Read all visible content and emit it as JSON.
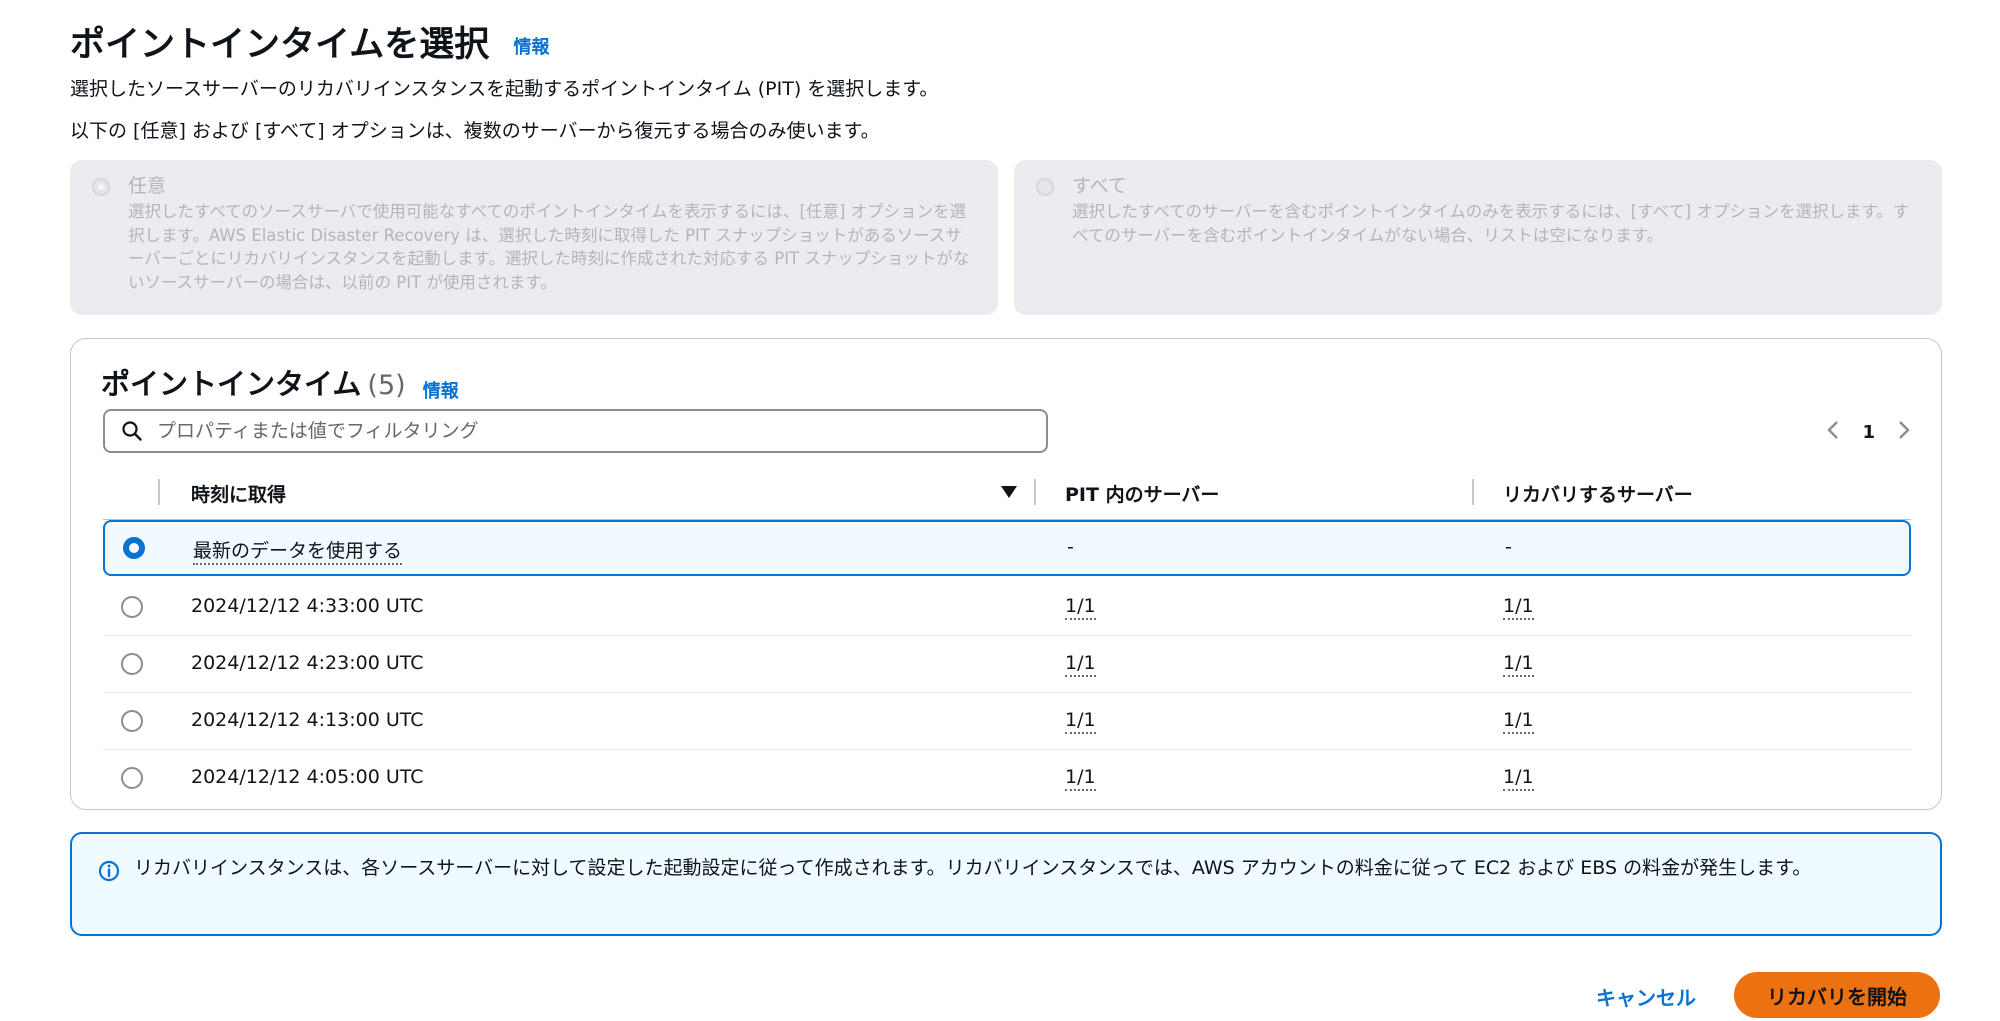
{
  "header": {
    "title": "ポイントインタイムを選択",
    "info_label": "情報",
    "description": "選択したソースサーバーのリカバリインスタンスを起動するポイントインタイム (PIT) を選択します。",
    "options_description": "以下の [任意] および [すべて] オプションは、複数のサーバーから復元する場合のみ使います。"
  },
  "options": [
    {
      "title": "任意",
      "description": "選択したすべてのソースサーバで使用可能なすべてのポイントインタイムを表示するには、[任意] オプションを選択します。AWS Elastic Disaster Recovery は、選択した時刻に取得した PIT スナップショットがあるソースサーバーごとにリカバリインスタンスを起動します。選択した時刻に作成された対応する PIT スナップショットがないソースサーバーの場合は、以前の PIT が使用されます。"
    },
    {
      "title": "すべて",
      "description": "選択したすべてのサーバーを含むポイントインタイムのみを表示するには、[すべて] オプションを選択します。すべてのサーバーを含むポイントインタイムがない場合、リストは空になります。"
    }
  ],
  "pit_table": {
    "title": "ポイントインタイム",
    "count": "(5)",
    "info_label": "情報",
    "filter_placeholder": "プロパティまたは値でフィルタリング",
    "page": "1",
    "columns": [
      "時刻に取得",
      "PIT 内のサーバー",
      "リカバリするサーバー"
    ],
    "rows": [
      {
        "time": "最新のデータを使用する",
        "pit_servers": "-",
        "recover_servers": "-"
      },
      {
        "time": "2024/12/12 4:33:00 UTC",
        "pit_servers": "1/1",
        "recover_servers": "1/1"
      },
      {
        "time": "2024/12/12 4:23:00 UTC",
        "pit_servers": "1/1",
        "recover_servers": "1/1"
      },
      {
        "time": "2024/12/12 4:13:00 UTC",
        "pit_servers": "1/1",
        "recover_servers": "1/1"
      },
      {
        "time": "2024/12/12 4:05:00 UTC",
        "pit_servers": "1/1",
        "recover_servers": "1/1"
      }
    ]
  },
  "alert": {
    "text": "リカバリインスタンスは、各ソースサーバーに対して設定した起動設定に従って作成されます。リカバリインスタンスでは、AWS アカウントの料金に従って EC2 および EBS の料金が発生します。"
  },
  "footer": {
    "cancel_label": "キャンセル",
    "start_label": "リカバリを開始"
  },
  "colors": {
    "accent": "#0972d3",
    "primary_button": "#ec7211",
    "disabled_card": "#ebebf0"
  },
  "icons": [
    "search-icon",
    "chevron-left-icon",
    "chevron-right-icon",
    "sort-down-icon",
    "info-icon"
  ]
}
